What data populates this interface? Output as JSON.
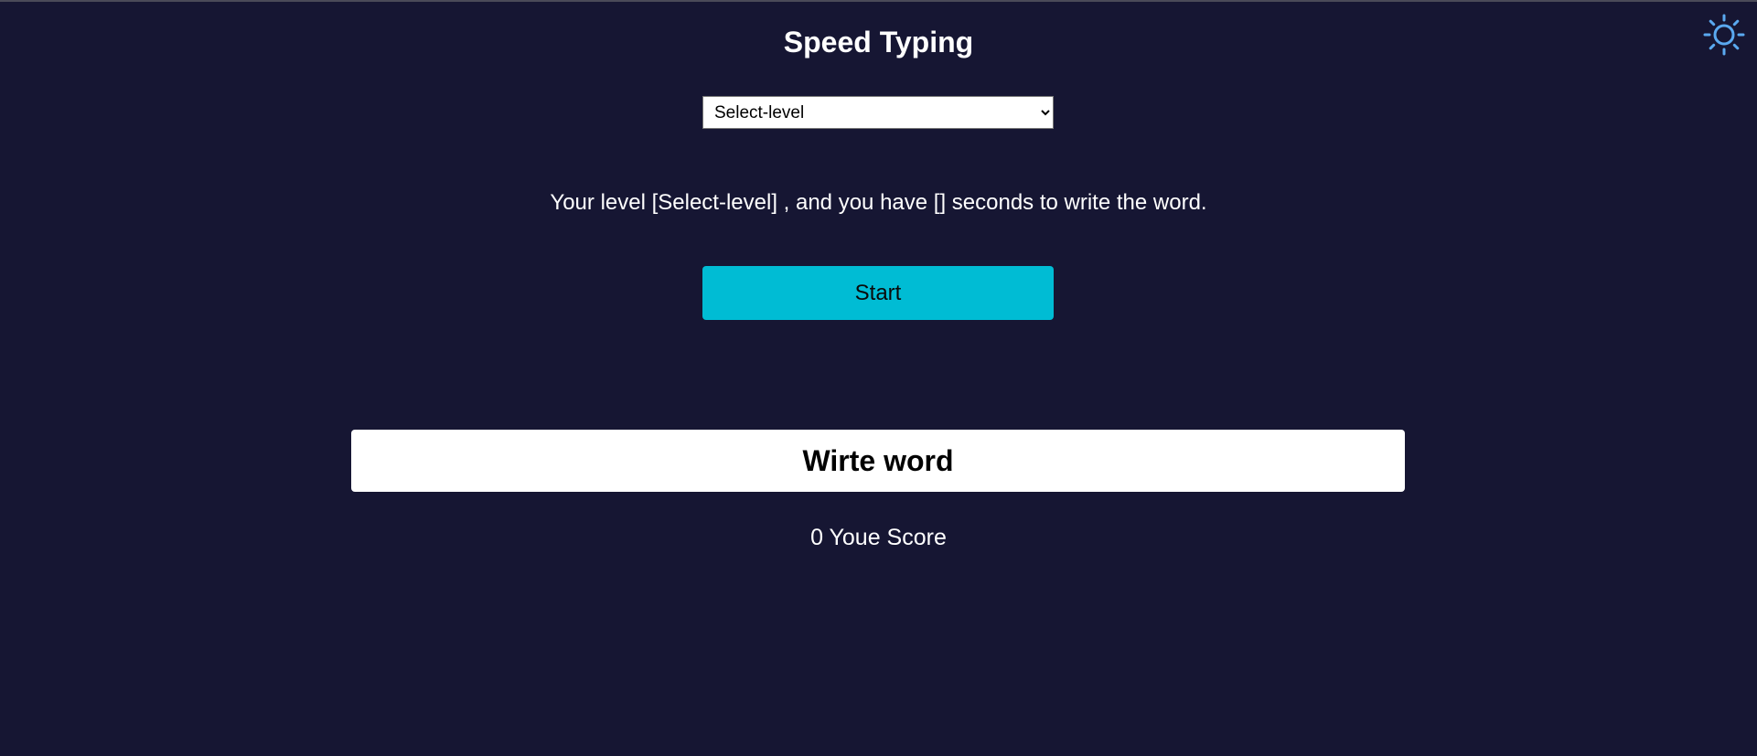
{
  "header": {
    "title": "Speed Typing",
    "theme_icon": "sun-icon"
  },
  "level_select": {
    "selected": "Select-level",
    "options": [
      "Select-level"
    ]
  },
  "message": "Your level [Select-level] , and you have [] seconds to write the word.",
  "start_button": {
    "label": "Start"
  },
  "word_display": {
    "text": "Wirte word"
  },
  "score": {
    "text": "0 Youe Score"
  },
  "colors": {
    "background": "#161633",
    "accent": "#00bcd4",
    "icon": "#5aa9f0"
  }
}
